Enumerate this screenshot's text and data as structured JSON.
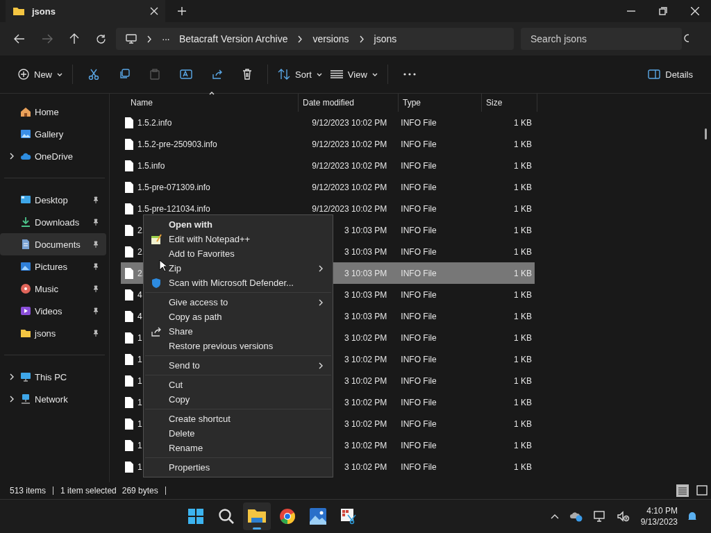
{
  "window": {
    "tab_title": "jsons"
  },
  "address": {
    "overflow": "···",
    "crumbs": [
      "Betacraft Version Archive",
      "versions",
      "jsons"
    ],
    "search_placeholder": "Search jsons"
  },
  "toolbar": {
    "new": "New",
    "sort": "Sort",
    "view": "View",
    "details": "Details"
  },
  "sidebar": {
    "items": [
      {
        "label": "Home",
        "pinned": false,
        "expandable": false,
        "selected": false
      },
      {
        "label": "Gallery",
        "pinned": false,
        "expandable": false,
        "selected": false
      },
      {
        "label": "OneDrive",
        "pinned": false,
        "expandable": true,
        "selected": false
      },
      {
        "kind": "separator"
      },
      {
        "label": "Desktop",
        "pinned": true,
        "expandable": false,
        "selected": false
      },
      {
        "label": "Downloads",
        "pinned": true,
        "expandable": false,
        "selected": false
      },
      {
        "label": "Documents",
        "pinned": true,
        "expandable": false,
        "selected": true
      },
      {
        "label": "Pictures",
        "pinned": true,
        "expandable": false,
        "selected": false
      },
      {
        "label": "Music",
        "pinned": true,
        "expandable": false,
        "selected": false
      },
      {
        "label": "Videos",
        "pinned": true,
        "expandable": false,
        "selected": false
      },
      {
        "label": "jsons",
        "pinned": true,
        "expandable": false,
        "selected": false
      },
      {
        "kind": "separator"
      },
      {
        "label": "This PC",
        "pinned": false,
        "expandable": true,
        "selected": false
      },
      {
        "label": "Network",
        "pinned": false,
        "expandable": true,
        "selected": false
      }
    ]
  },
  "table": {
    "columns": [
      "Name",
      "Date modified",
      "Type",
      "Size"
    ],
    "rows": [
      {
        "name": "1.5.2.info",
        "date": "9/12/2023 10:02 PM",
        "type": "INFO File",
        "size": "1 KB",
        "selected": false
      },
      {
        "name": "1.5.2-pre-250903.info",
        "date": "9/12/2023 10:02 PM",
        "type": "INFO File",
        "size": "1 KB",
        "selected": false
      },
      {
        "name": "1.5.info",
        "date": "9/12/2023 10:02 PM",
        "type": "INFO File",
        "size": "1 KB",
        "selected": false
      },
      {
        "name": "1.5-pre-071309.info",
        "date": "9/12/2023 10:02 PM",
        "type": "INFO File",
        "size": "1 KB",
        "selected": false
      },
      {
        "name": "1.5-pre-121034.info",
        "date": "9/12/2023 10:02 PM",
        "type": "INFO File",
        "size": "1 KB",
        "selected": false
      },
      {
        "name": "2.",
        "date": "3 10:03 PM",
        "type": "INFO File",
        "size": "1 KB",
        "selected": false
      },
      {
        "name": "2.",
        "date": "3 10:03 PM",
        "type": "INFO File",
        "size": "1 KB",
        "selected": false
      },
      {
        "name": "2.",
        "date": "3 10:03 PM",
        "type": "INFO File",
        "size": "1 KB",
        "selected": true
      },
      {
        "name": "4",
        "date": "3 10:03 PM",
        "type": "INFO File",
        "size": "1 KB",
        "selected": false
      },
      {
        "name": "4",
        "date": "3 10:03 PM",
        "type": "INFO File",
        "size": "1 KB",
        "selected": false
      },
      {
        "name": "1",
        "date": "3 10:02 PM",
        "type": "INFO File",
        "size": "1 KB",
        "selected": false
      },
      {
        "name": "1",
        "date": "3 10:02 PM",
        "type": "INFO File",
        "size": "1 KB",
        "selected": false
      },
      {
        "name": "1",
        "date": "3 10:02 PM",
        "type": "INFO File",
        "size": "1 KB",
        "selected": false
      },
      {
        "name": "1",
        "date": "3 10:02 PM",
        "type": "INFO File",
        "size": "1 KB",
        "selected": false
      },
      {
        "name": "1",
        "date": "3 10:02 PM",
        "type": "INFO File",
        "size": "1 KB",
        "selected": false
      },
      {
        "name": "1",
        "date": "3 10:02 PM",
        "type": "INFO File",
        "size": "1 KB",
        "selected": false
      },
      {
        "name": "1",
        "date": "3 10:02 PM",
        "type": "INFO File",
        "size": "1 KB",
        "selected": false
      }
    ]
  },
  "context_menu": {
    "groups": [
      [
        {
          "label": "Open with",
          "bold": true,
          "submenu": false
        },
        {
          "label": "Edit with Notepad++",
          "bold": false,
          "submenu": false
        },
        {
          "label": "Add to Favorites",
          "bold": false,
          "submenu": false
        },
        {
          "label": "Zip",
          "bold": false,
          "submenu": true
        },
        {
          "label": "Scan with Microsoft Defender...",
          "bold": false,
          "submenu": false
        }
      ],
      [
        {
          "label": "Give access to",
          "bold": false,
          "submenu": true
        },
        {
          "label": "Copy as path",
          "bold": false,
          "submenu": false
        },
        {
          "label": "Share",
          "bold": false,
          "submenu": false
        },
        {
          "label": "Restore previous versions",
          "bold": false,
          "submenu": false
        }
      ],
      [
        {
          "label": "Send to",
          "bold": false,
          "submenu": true
        }
      ],
      [
        {
          "label": "Cut",
          "bold": false,
          "submenu": false
        },
        {
          "label": "Copy",
          "bold": false,
          "submenu": false
        }
      ],
      [
        {
          "label": "Create shortcut",
          "bold": false,
          "submenu": false
        },
        {
          "label": "Delete",
          "bold": false,
          "submenu": false
        },
        {
          "label": "Rename",
          "bold": false,
          "submenu": false
        }
      ],
      [
        {
          "label": "Properties",
          "bold": false,
          "submenu": false
        }
      ]
    ]
  },
  "status_bar": {
    "count": "513 items",
    "selection": "1 item selected",
    "size": "269 bytes"
  },
  "taskbar": {
    "time": "4:10 PM",
    "date": "9/13/2023"
  }
}
